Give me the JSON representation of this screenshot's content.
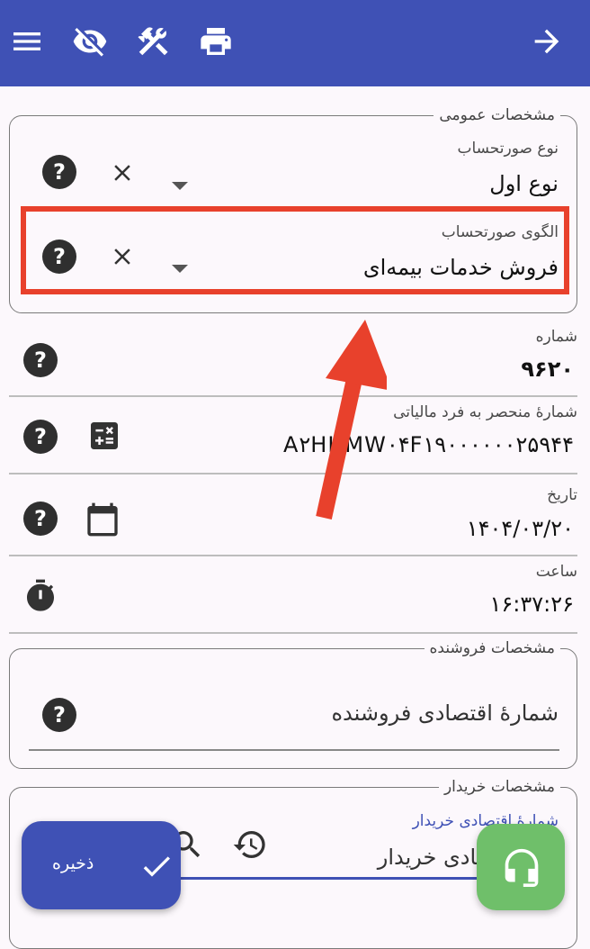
{
  "appbar": {
    "icons": [
      "menu-icon",
      "visibility-off-icon",
      "tools-icon",
      "print-icon",
      "arrow-forward-icon"
    ],
    "bg": "#3f51b5"
  },
  "general": {
    "legend": "مشخصات عمومی",
    "invoice_type": {
      "label": "نوع صورتحساب",
      "value": "نوع اول"
    },
    "invoice_pattern": {
      "label": "الگوی صورتحساب",
      "value": "فروش خدمات بیمه‌ای"
    }
  },
  "number": {
    "label": "شماره",
    "value": "۹۶۲۰"
  },
  "tax_id": {
    "label": "شمارهٔ منحصر به فرد مالیاتی",
    "value": "A۲HHMW۰۴F۱۹۰۰۰۰۰۰۲۵۹۴۴"
  },
  "date": {
    "label": "تاریخ",
    "value": "۱۴۰۴/۰۳/۲۰"
  },
  "time": {
    "label": "ساعت",
    "value": "۱۶:۳۷:۲۶"
  },
  "seller": {
    "legend": "مشخصات فروشنده",
    "economic_no_placeholder": "شمارهٔ اقتصادی فروشنده"
  },
  "buyer": {
    "legend": "مشخصات خریدار",
    "economic_no_label": "شمارهٔ اقتصادی خریدار",
    "economic_no_placeholder": "اقتصادی خریدار"
  },
  "actions": {
    "save_label": "ذخیره"
  },
  "help_glyph": "?",
  "colors": {
    "primary": "#3f51b5",
    "highlight": "#e8412c",
    "support": "#6fbf6a"
  }
}
